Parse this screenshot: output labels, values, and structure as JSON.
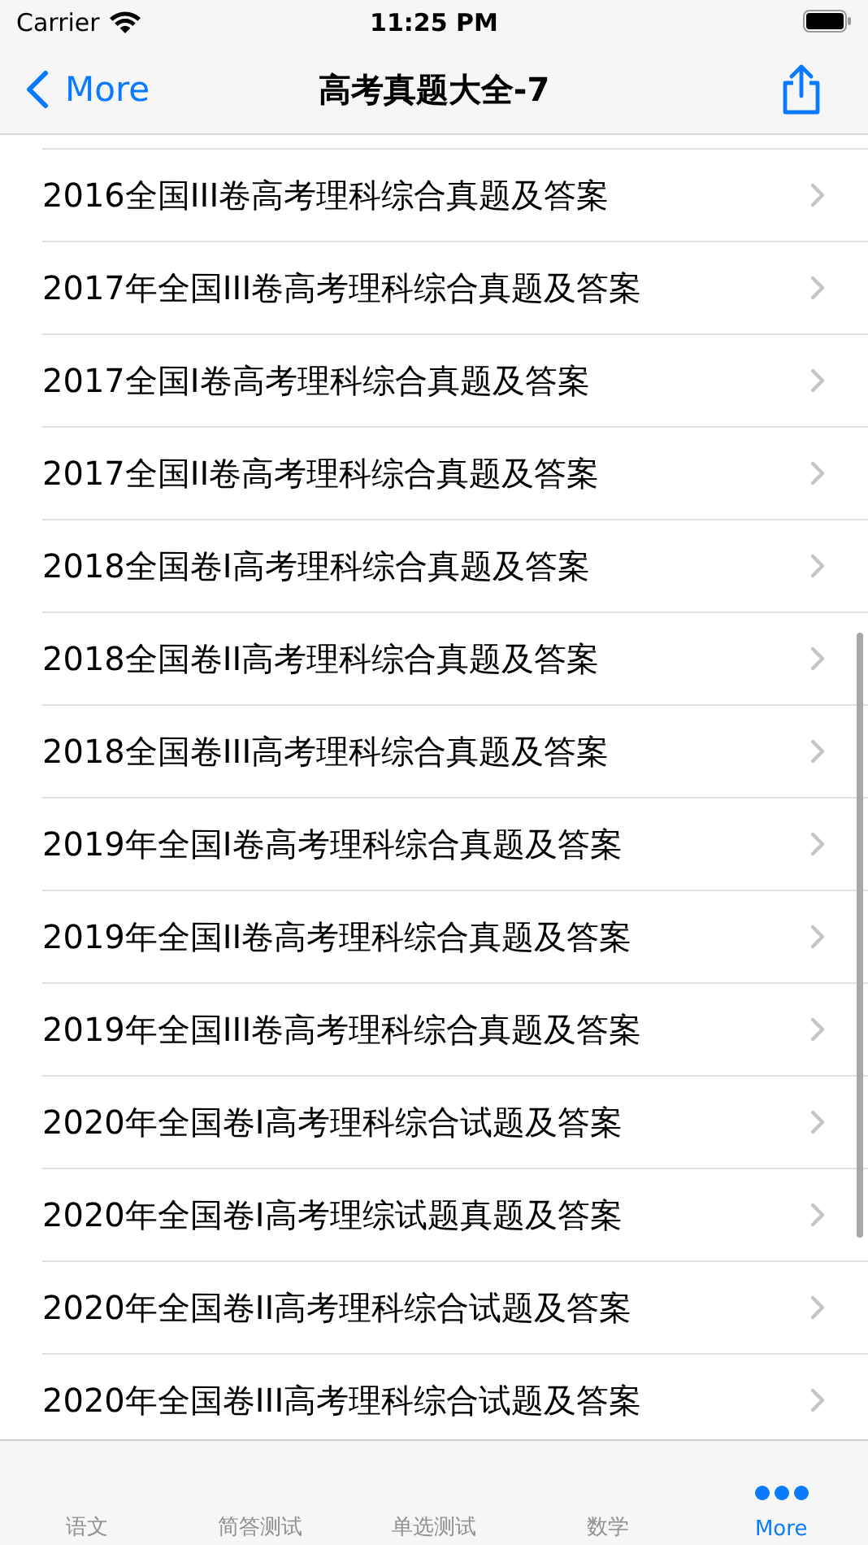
{
  "status_bar": {
    "carrier": "Carrier",
    "time": "11:25 PM"
  },
  "nav_bar": {
    "back": "More",
    "title": "高考真题大全-7"
  },
  "rows": [
    "2016全国III卷高考理科综合真题及答案",
    "2017年全国III卷高考理科综合真题及答案",
    "2017全国I卷高考理科综合真题及答案",
    "2017全国II卷高考理科综合真题及答案",
    "2018全国卷I高考理科综合真题及答案",
    "2018全国卷II高考理科综合真题及答案",
    "2018全国卷III高考理科综合真题及答案",
    "2019年全国I卷高考理科综合真题及答案",
    "2019年全国II卷高考理科综合真题及答案",
    "2019年全国III卷高考理科综合真题及答案",
    "2020年全国卷I高考理科综合试题及答案",
    "2020年全国卷I高考理综试题真题及答案",
    "2020年全国卷II高考理科综合试题及答案",
    "2020年全国卷III高考理科综合试题及答案"
  ],
  "tabs": [
    {
      "label": "语文",
      "selected": false
    },
    {
      "label": "简答测试",
      "selected": false
    },
    {
      "label": "单选测试",
      "selected": false
    },
    {
      "label": "数学",
      "selected": false
    },
    {
      "label": "More",
      "selected": true,
      "kind": "more"
    }
  ]
}
